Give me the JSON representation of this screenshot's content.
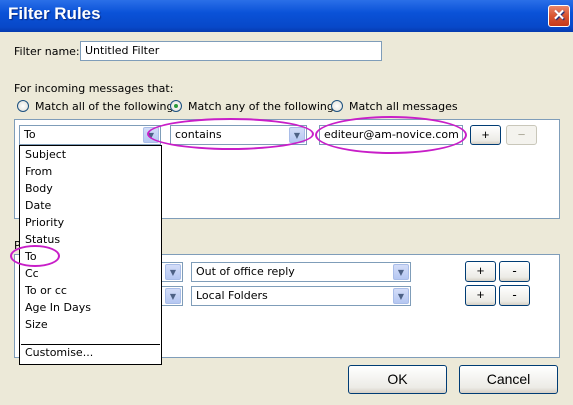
{
  "window": {
    "title": "Filter Rules",
    "close_glyph": "✕"
  },
  "filter_name": {
    "label": "Filter name:",
    "value": "Untitled Filter"
  },
  "incoming": {
    "label": "For incoming messages that:",
    "options": [
      {
        "label": "Match all of the following",
        "checked": false
      },
      {
        "label": "Match any of the following",
        "checked": true
      },
      {
        "label": "Match all messages",
        "checked": false
      }
    ]
  },
  "rule": {
    "field": "To",
    "operator": "contains",
    "value": "editeur@am-novice.com",
    "add_label": "+",
    "remove_label": "−"
  },
  "field_dropdown": {
    "items": [
      "Subject",
      "From",
      "Body",
      "Date",
      "Priority",
      "Status",
      "To",
      "Cc",
      "To or cc",
      "Age In Days",
      "Size"
    ],
    "customise_label": "Customise..."
  },
  "actions": {
    "rows": [
      {
        "value": "Out of office reply",
        "add_label": "+",
        "remove_label": "-"
      },
      {
        "value": "Local Folders",
        "add_label": "+",
        "remove_label": "-"
      }
    ],
    "partial_label": "P"
  },
  "buttons": {
    "ok": "OK",
    "cancel": "Cancel"
  },
  "colors": {
    "annotation": "#c81ec8",
    "title_bar": "#0a52d8"
  }
}
